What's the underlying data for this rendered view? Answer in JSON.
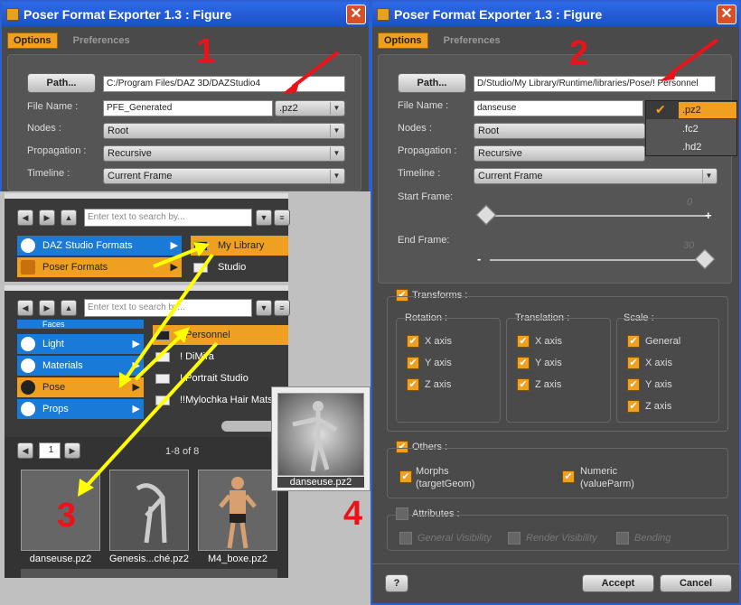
{
  "win1": {
    "title": "Poser Format Exporter 1.3 : Figure",
    "tab_options": "Options",
    "tab_preferences": "Preferences",
    "badge": "1",
    "path_button": "Path...",
    "path_value": "C:/Program Files/DAZ 3D/DAZStudio4",
    "file_name_label": "File Name :",
    "file_name_value": "PFE_Generated",
    "file_ext": ".pz2",
    "nodes_label": "Nodes :",
    "nodes_value": "Root",
    "propagation_label": "Propagation :",
    "propagation_value": "Recursive",
    "timeline_label": "Timeline :",
    "timeline_value": "Current Frame"
  },
  "win2": {
    "title": "Poser Format Exporter 1.3 : Figure",
    "tab_options": "Options",
    "tab_preferences": "Preferences",
    "badge": "2",
    "path_button": "Path...",
    "path_value": "D/Studio/My Library/Runtime/libraries/Pose/! Personnel",
    "file_name_label": "File Name :",
    "file_name_value": "danseuse",
    "ext_options": [
      ".pz2",
      ".fc2",
      ".hd2"
    ],
    "nodes_label": "Nodes :",
    "nodes_value": "Root",
    "propagation_label": "Propagation :",
    "propagation_value": "Recursive",
    "timeline_label": "Timeline :",
    "timeline_value": "Current Frame",
    "start_frame_label": "Start Frame:",
    "start_frame_value": "0",
    "end_frame_label": "End Frame:",
    "end_frame_value": "30",
    "plus": "+",
    "minus": "-",
    "transforms_label": "Transforms :",
    "rotation_label": "Rotation :",
    "translation_label": "Translation :",
    "scale_label": "Scale :",
    "x_axis": "X axis",
    "y_axis": "Y axis",
    "z_axis": "Z axis",
    "general": "General",
    "others_label": "Others :",
    "morphs_label": "Morphs",
    "morphs_sub": "(targetGeom)",
    "numeric_label": "Numeric",
    "numeric_sub": "(valueParm)",
    "attributes_label": "Attributes :",
    "general_visibility": "General Visibility",
    "render_visibility": "Render Visibility",
    "bending": "Bending",
    "accept_button": "Accept",
    "cancel_button": "Cancel"
  },
  "lib1": {
    "search_placeholder": "Enter text to search by...",
    "cat_daz": "DAZ Studio Formats",
    "cat_poser": "Poser Formats",
    "folder_mylibrary": "My Library",
    "folder_studio": "Studio"
  },
  "lib2": {
    "search_placeholder": "Enter text to search by...",
    "cat_faces": "Faces",
    "cat_light": "Light",
    "cat_materials": "Materials",
    "cat_pose": "Pose",
    "cat_props": "Props",
    "folder_personnel": "! Personnel",
    "folder_dimira": "! DiMira",
    "folder_portrait": "! Portrait Studio",
    "folder_mylochka": "!!Mylochka Hair Mats",
    "page_num": "1",
    "page_range": "1-8 of 8",
    "thumb1": "danseuse.pz2",
    "thumb2": "Genesis...ché.pz2",
    "thumb3": "M4_boxe.pz2",
    "badge": "3"
  },
  "popup": {
    "label": "danseuse.pz2",
    "badge": "4"
  },
  "colors": {
    "accent_orange": "#f0a020",
    "titlebar_blue": "#2d6ae8",
    "badge_red": "#e8141a",
    "arrow_yellow": "#ffff00"
  }
}
